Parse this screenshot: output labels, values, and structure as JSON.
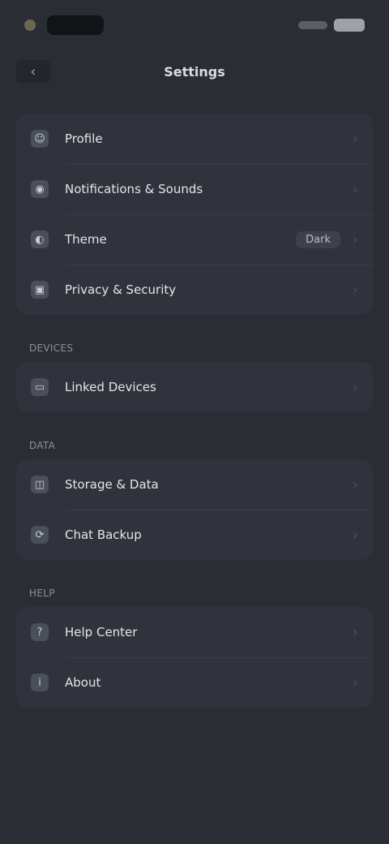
{
  "status_bar": {},
  "top_bar": {
    "back_glyph": "‹",
    "title": "Settings"
  },
  "groups": [
    {
      "section_label": "",
      "items": [
        {
          "icon": "user-icon",
          "glyph": "☺",
          "label": "Profile",
          "value": ""
        },
        {
          "icon": "notification-icon",
          "glyph": "◉",
          "label": "Notifications & Sounds",
          "value": ""
        },
        {
          "icon": "theme-icon",
          "glyph": "◐",
          "label": "Theme",
          "value": "Dark"
        },
        {
          "icon": "privacy-icon",
          "glyph": "▣",
          "label": "Privacy & Security",
          "value": ""
        }
      ]
    },
    {
      "section_label": "DEVICES",
      "items": [
        {
          "icon": "device-icon",
          "glyph": "▭",
          "label": "Linked Devices",
          "value": ""
        }
      ]
    },
    {
      "section_label": "DATA",
      "items": [
        {
          "icon": "storage-icon",
          "glyph": "◫",
          "label": "Storage & Data",
          "value": ""
        },
        {
          "icon": "backup-icon",
          "glyph": "⟳",
          "label": "Chat Backup",
          "value": ""
        }
      ]
    },
    {
      "section_label": "HELP",
      "items": [
        {
          "icon": "help-icon",
          "glyph": "?",
          "label": "Help Center",
          "value": ""
        },
        {
          "icon": "info-icon",
          "glyph": "i",
          "label": "About",
          "value": ""
        }
      ]
    }
  ],
  "chevron_glyph": "›"
}
